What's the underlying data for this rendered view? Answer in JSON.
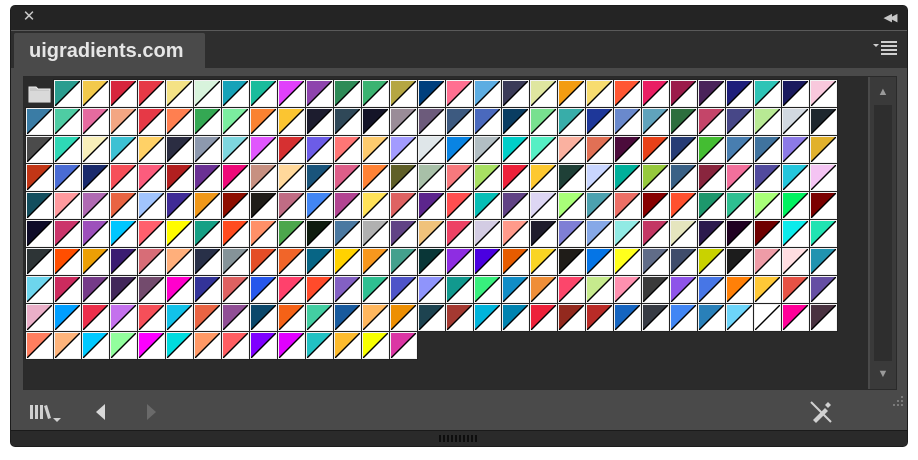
{
  "window": {
    "close_glyph": "✕",
    "collapse_glyph": "◀◀"
  },
  "tab": {
    "title": "uigradients.com"
  },
  "scroll": {
    "up_glyph": "▲",
    "down_glyph": "▼"
  },
  "icons": {
    "close": "close-icon",
    "collapse": "double-chevron-icon",
    "flyout": "menu-icon",
    "folder": "folder-icon",
    "libraries": "swatch-libraries-icon",
    "previous": "previous-arrow-icon",
    "next": "next-arrow-icon",
    "no_edit": "no-edit-icon"
  },
  "swatches": {
    "columns": 29,
    "colors": [
      "#2a9d8f",
      "#f2c94c",
      "#d7263d",
      "#e63946",
      "#f4e285",
      "#d8f3dc",
      "#17a2b8",
      "#1abc9c",
      "#e040fb",
      "#8e44ad",
      "#2e8b57",
      "#3cb371",
      "#b5a642",
      "#003f7d",
      "#ff6f91",
      "#5dade2",
      "#3b3b58",
      "#dfe6a0",
      "#f39c12",
      "#f7dc6f",
      "#ff5733",
      "#e91e63",
      "#9b1b4a",
      "#4a235a",
      "#1e1e7a",
      "#2ec4b6",
      "#1a1a5e",
      "#f8c8dc",
      "#3a7ca5",
      "#4ecca3",
      "#e56b9f",
      "#f3a683",
      "#e63946",
      "#ff7f50",
      "#34a853",
      "#7bed9f",
      "#fa8231",
      "#fbc531",
      "#1c1c2e",
      "#2f4858",
      "#141428",
      "#9a8c98",
      "#6c5b7b",
      "#3d5a80",
      "#4a69bd",
      "#0a3d62",
      "#78e08f",
      "#38ada9",
      "#1e3799",
      "#6a89cc",
      "#60a3bc",
      "#2d6e3e",
      "#c44569",
      "#474787",
      "#b8e994",
      "#d1d8e0",
      "#1e272e",
      "#4b4b4b",
      "#2ed8b6",
      "#f8efba",
      "#3dc1d3",
      "#ffd166",
      "#2b2d42",
      "#8d99ae",
      "#7ed6df",
      "#e056fd",
      "#d63031",
      "#6c5ce7",
      "#ff7675",
      "#fdcb6e",
      "#a29bfe",
      "#dfe6e9",
      "#0984e3",
      "#b2bec3",
      "#00cec9",
      "#55efc4",
      "#fab1a0",
      "#e17055",
      "#4b0b3b",
      "#e84118",
      "#273c75",
      "#44bd32",
      "#487eb0",
      "#40739e",
      "#8c7ae6",
      "#e1b12c",
      "#c23616",
      "#4a6cd4",
      "#1a2a6c",
      "#f64f59",
      "#fc5c7d",
      "#b21f1f",
      "#6a3093",
      "#ee0979",
      "#c79081",
      "#ffd89b",
      "#19547b",
      "#dd5e89",
      "#ff8235",
      "#5f5f28",
      "#a8c0a8",
      "#f7797d",
      "#a8e063",
      "#ed213a",
      "#fdc830",
      "#1f4037",
      "#c9d6ff",
      "#00b09b",
      "#96c93d",
      "#3a6186",
      "#89253e",
      "#f2709c",
      "#514a9d",
      "#24c6dc",
      "#f4c4f3",
      "#134e5e",
      "#ff9a9e",
      "#b06ab3",
      "#e96443",
      "#a1c4fd",
      "#3f2b96",
      "#f09819",
      "#8e0e00",
      "#1f1c18",
      "#c06c84",
      "#4286f4",
      "#b24592",
      "#ffe259",
      "#de6262",
      "#5c258d",
      "#ff4e50",
      "#06beb6",
      "#614385",
      "#ddd6f3",
      "#a8ff78",
      "#4ca1af",
      "#ec6f66",
      "#870000",
      "#ff512f",
      "#1d976c",
      "#2ebf91",
      "#a8ff78",
      "#00f260",
      "#7b0000",
      "#0f0c29",
      "#cb356b",
      "#9d50bb",
      "#00c6ff",
      "#ff5f6d",
      "#fffc00",
      "#16a085",
      "#ff4b1f",
      "#ff9068",
      "#4ca64c",
      "#0f1c0f",
      "#4b79a1",
      "#b0b0b0",
      "#614385",
      "#f0c27b",
      "#ed4264",
      "#d3cce3",
      "#ff9a8b",
      "#1f1c2c",
      "#7f7fd5",
      "#86a8e7",
      "#91eae4",
      "#c33764",
      "#e5e5be",
      "#2c1a4d",
      "#200122",
      "#6f0000",
      "#0cebeb",
      "#20e3b2",
      "#2d3436",
      "#ff4e00",
      "#ec9f05",
      "#3a1c71",
      "#d76d77",
      "#ffaf7b",
      "#283048",
      "#859398",
      "#e44d26",
      "#f16529",
      "#076585",
      "#ffd200",
      "#f7971e",
      "#44a08d",
      "#093637",
      "#8e2de2",
      "#4a00e0",
      "#e65c00",
      "#f9d423",
      "#1f1c18",
      "#0575e6",
      "#ffff1c",
      "#606c88",
      "#3f4c6b",
      "#c9d200",
      "#1c1c1c",
      "#ee9ca7",
      "#ffdde1",
      "#2193b0",
      "#6dd5ed",
      "#cc2b5e",
      "#753a88",
      "#42275a",
      "#734b6d",
      "#ff00cc",
      "#333399",
      "#de6161",
      "#2657eb",
      "#ff416c",
      "#ff4b2b",
      "#8360c3",
      "#2ebf91",
      "#4e54c8",
      "#8f94fb",
      "#11998e",
      "#38ef7d",
      "#108dc7",
      "#ef8e38",
      "#fc466b",
      "#c6ea8d",
      "#fe90af",
      "#3a3a3a",
      "#8e54e9",
      "#4776e6",
      "#ff8008",
      "#ffc837",
      "#e65245",
      "#654ea3",
      "#eaafc8",
      "#009fff",
      "#ec2f4b",
      "#c471ed",
      "#f64f59",
      "#12c2e9",
      "#e96443",
      "#904e95",
      "#0b486b",
      "#f56217",
      "#43cea2",
      "#185a9d",
      "#ffb75e",
      "#ed8f03",
      "#1d4350",
      "#a43931",
      "#00b4db",
      "#0083b0",
      "#ed213a",
      "#93291e",
      "#b92b27",
      "#1565c0",
      "#373b44",
      "#4286f4",
      "#2980b9",
      "#6dd5fa",
      "#ffffff",
      "#ff0099",
      "#493240",
      "#ff7e5f",
      "#feb47b",
      "#00c9ff",
      "#92fe9d",
      "#fc00ff",
      "#00dbde",
      "#ff9966",
      "#ff5e62",
      "#7f00ff",
      "#e100ff",
      "#22c1c3",
      "#fdbb2d",
      "#f7ff00",
      "#db36a4"
    ]
  }
}
